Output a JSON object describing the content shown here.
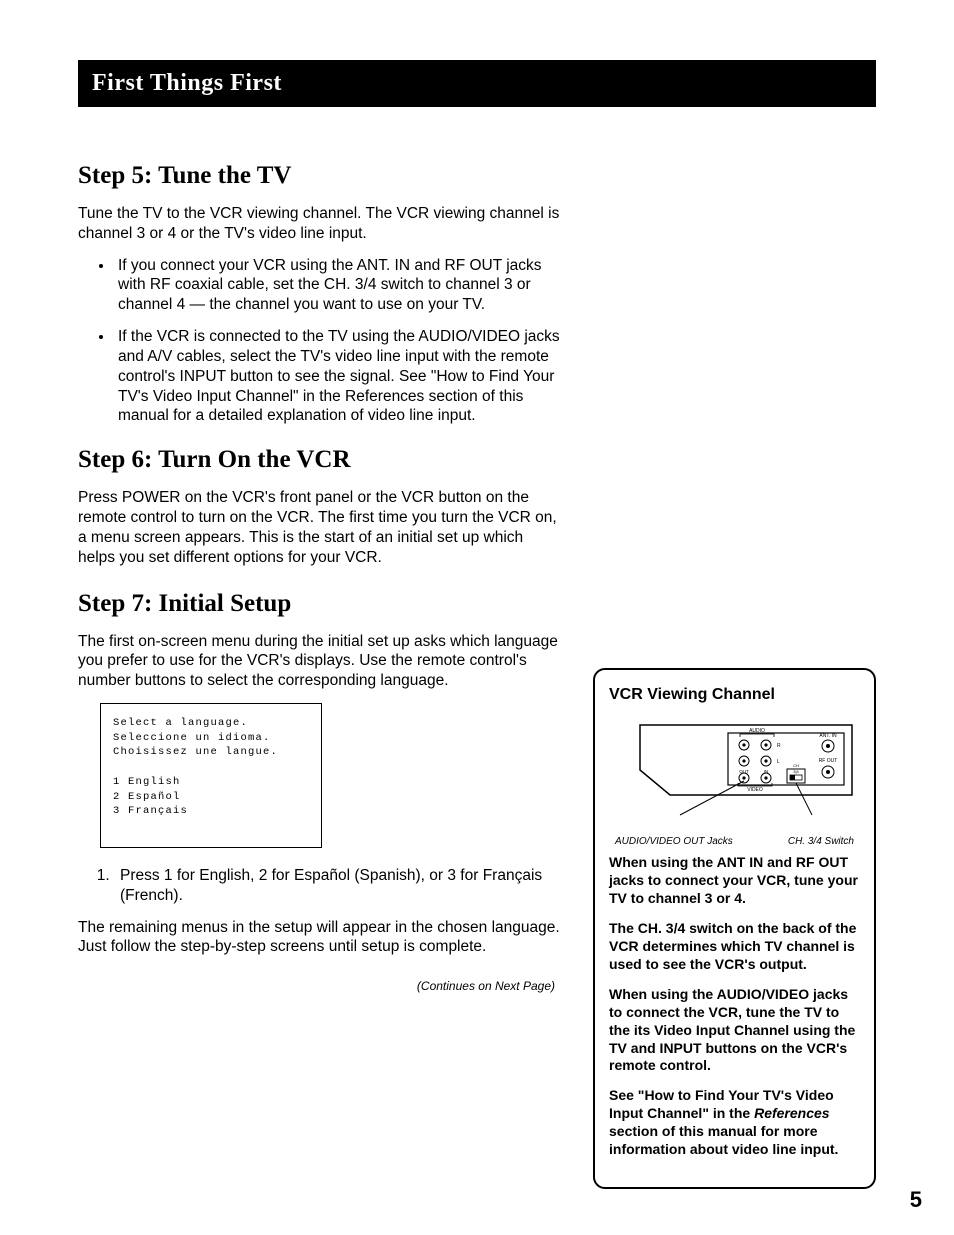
{
  "header": "First Things First",
  "step5": {
    "title": "Step 5: Tune the TV",
    "intro": "Tune the TV to the VCR viewing channel. The VCR viewing channel is channel 3 or 4 or the TV's video line input.",
    "bullets": [
      "If you connect your VCR using the ANT. IN and RF OUT jacks with RF coaxial cable, set the CH. 3/4 switch to channel 3 or channel 4 — the channel you want to use on your TV.",
      "If the VCR is connected to the TV using the AUDIO/VIDEO jacks and A/V cables, select the TV's video line input with the remote control's INPUT button to see the signal. See \"How to Find Your TV's Video Input Channel\" in the References section of this manual for a detailed explanation of video line input."
    ]
  },
  "step6": {
    "title": "Step 6: Turn On the VCR",
    "body": "Press POWER on the VCR's front panel or the VCR button on the remote control to turn on the VCR. The first time you turn the VCR on, a menu screen appears. This is the start of an initial set up which helps you set different options for your VCR."
  },
  "step7": {
    "title": "Step 7: Initial Setup",
    "intro": "The first on-screen menu during the initial set up asks which language you prefer to use for the VCR's displays. Use the remote control's number buttons to select the corresponding language.",
    "screen": "Select a language.\nSeleccione un idioma.\nChoisissez une langue.\n\n1 English\n2 Español\n3 Français",
    "ol1": "Press 1 for English, 2 for Español (Spanish), or 3 for Français (French).",
    "after": "The remaining menus in the setup will appear in the chosen language. Just follow the step-by-step screens until setup is complete."
  },
  "continues": "(Continues on Next Page)",
  "sidebar": {
    "title": "VCR Viewing Channel",
    "diag_label_left": "AUDIO/VIDEO OUT Jacks",
    "diag_label_right": "CH. 3/4 Switch",
    "panel_labels": {
      "audio": "AUDIO",
      "ant_in": "ANT. IN",
      "rf_out": "RF OUT",
      "r": "R",
      "l": "L",
      "out": "OUT",
      "in": "IN",
      "video": "VIDEO",
      "ch34": "CH\n3|4"
    },
    "p1": "When using the ANT IN and RF OUT jacks to connect your VCR, tune your TV to channel 3 or 4.",
    "p2": "The CH. 3/4 switch on the back of the VCR determines which TV channel is used to see the VCR's output.",
    "p3": "When using the AUDIO/VIDEO jacks to connect the VCR, tune the TV to the its Video Input Channel using the TV and INPUT buttons on the VCR's remote control.",
    "p4_a": "See \"How to Find Your TV's Video Input Channel\" in the ",
    "p4_ref": "References",
    "p4_b": " section of this manual for more information about video line input."
  },
  "page_number": "5"
}
